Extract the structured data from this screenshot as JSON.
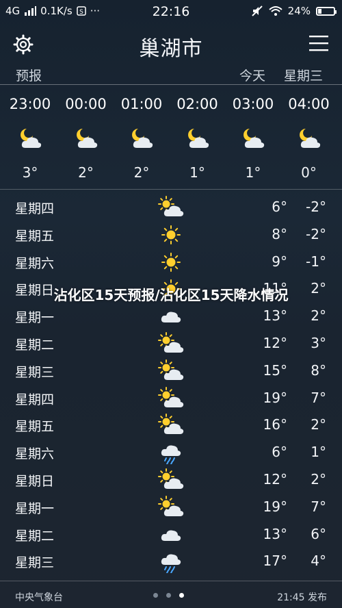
{
  "status": {
    "network": "4G",
    "speed": "0.1K/s",
    "time": "22:16",
    "battery": "24%",
    "battery_level": 0.24
  },
  "header": {
    "title": "巢湖市"
  },
  "subheader": {
    "label": "预报",
    "today": "今天",
    "weekday": "星期三"
  },
  "hourly": [
    {
      "time": "23:00",
      "temp": "3°",
      "icon": "moon-cloud-icon"
    },
    {
      "time": "00:00",
      "temp": "2°",
      "icon": "moon-cloud-icon"
    },
    {
      "time": "01:00",
      "temp": "2°",
      "icon": "moon-cloud-icon"
    },
    {
      "time": "02:00",
      "temp": "1°",
      "icon": "moon-cloud-icon"
    },
    {
      "time": "03:00",
      "temp": "1°",
      "icon": "moon-cloud-icon"
    },
    {
      "time": "04:00",
      "temp": "0°",
      "icon": "moon-cloud-icon"
    }
  ],
  "daily": [
    {
      "day": "星期四",
      "icon": "sun-cloud-icon",
      "hi": "6°",
      "lo": "-2°"
    },
    {
      "day": "星期五",
      "icon": "sun-icon",
      "hi": "8°",
      "lo": "-2°"
    },
    {
      "day": "星期六",
      "icon": "sun-icon",
      "hi": "9°",
      "lo": "-1°"
    },
    {
      "day": "星期日",
      "icon": "sun-icon",
      "hi": "11°",
      "lo": "2°"
    },
    {
      "day": "星期一",
      "icon": "cloud-icon",
      "hi": "13°",
      "lo": "2°"
    },
    {
      "day": "星期二",
      "icon": "sun-cloud-icon",
      "hi": "12°",
      "lo": "3°"
    },
    {
      "day": "星期三",
      "icon": "sun-cloud-icon",
      "hi": "15°",
      "lo": "8°"
    },
    {
      "day": "星期四",
      "icon": "sun-cloud-icon",
      "hi": "19°",
      "lo": "7°"
    },
    {
      "day": "星期五",
      "icon": "sun-cloud-icon",
      "hi": "16°",
      "lo": "2°"
    },
    {
      "day": "星期六",
      "icon": "rain-icon",
      "hi": "6°",
      "lo": "1°"
    },
    {
      "day": "星期日",
      "icon": "sun-cloud-icon",
      "hi": "12°",
      "lo": "2°"
    },
    {
      "day": "星期一",
      "icon": "sun-cloud-icon",
      "hi": "19°",
      "lo": "7°"
    },
    {
      "day": "星期二",
      "icon": "cloud-icon",
      "hi": "13°",
      "lo": "6°"
    },
    {
      "day": "星期三",
      "icon": "rain-icon",
      "hi": "17°",
      "lo": "4°"
    }
  ],
  "footer": {
    "source": "中央气象台",
    "published": "21:45 发布",
    "page_count": 3,
    "active_page": 3
  },
  "overlay": {
    "text": "沾化区15天预报/沾化区15天降水情况"
  },
  "colors": {
    "sun": "#ffcf2e",
    "cloud": "#e7ecf1",
    "rain": "#4aa8ff"
  }
}
